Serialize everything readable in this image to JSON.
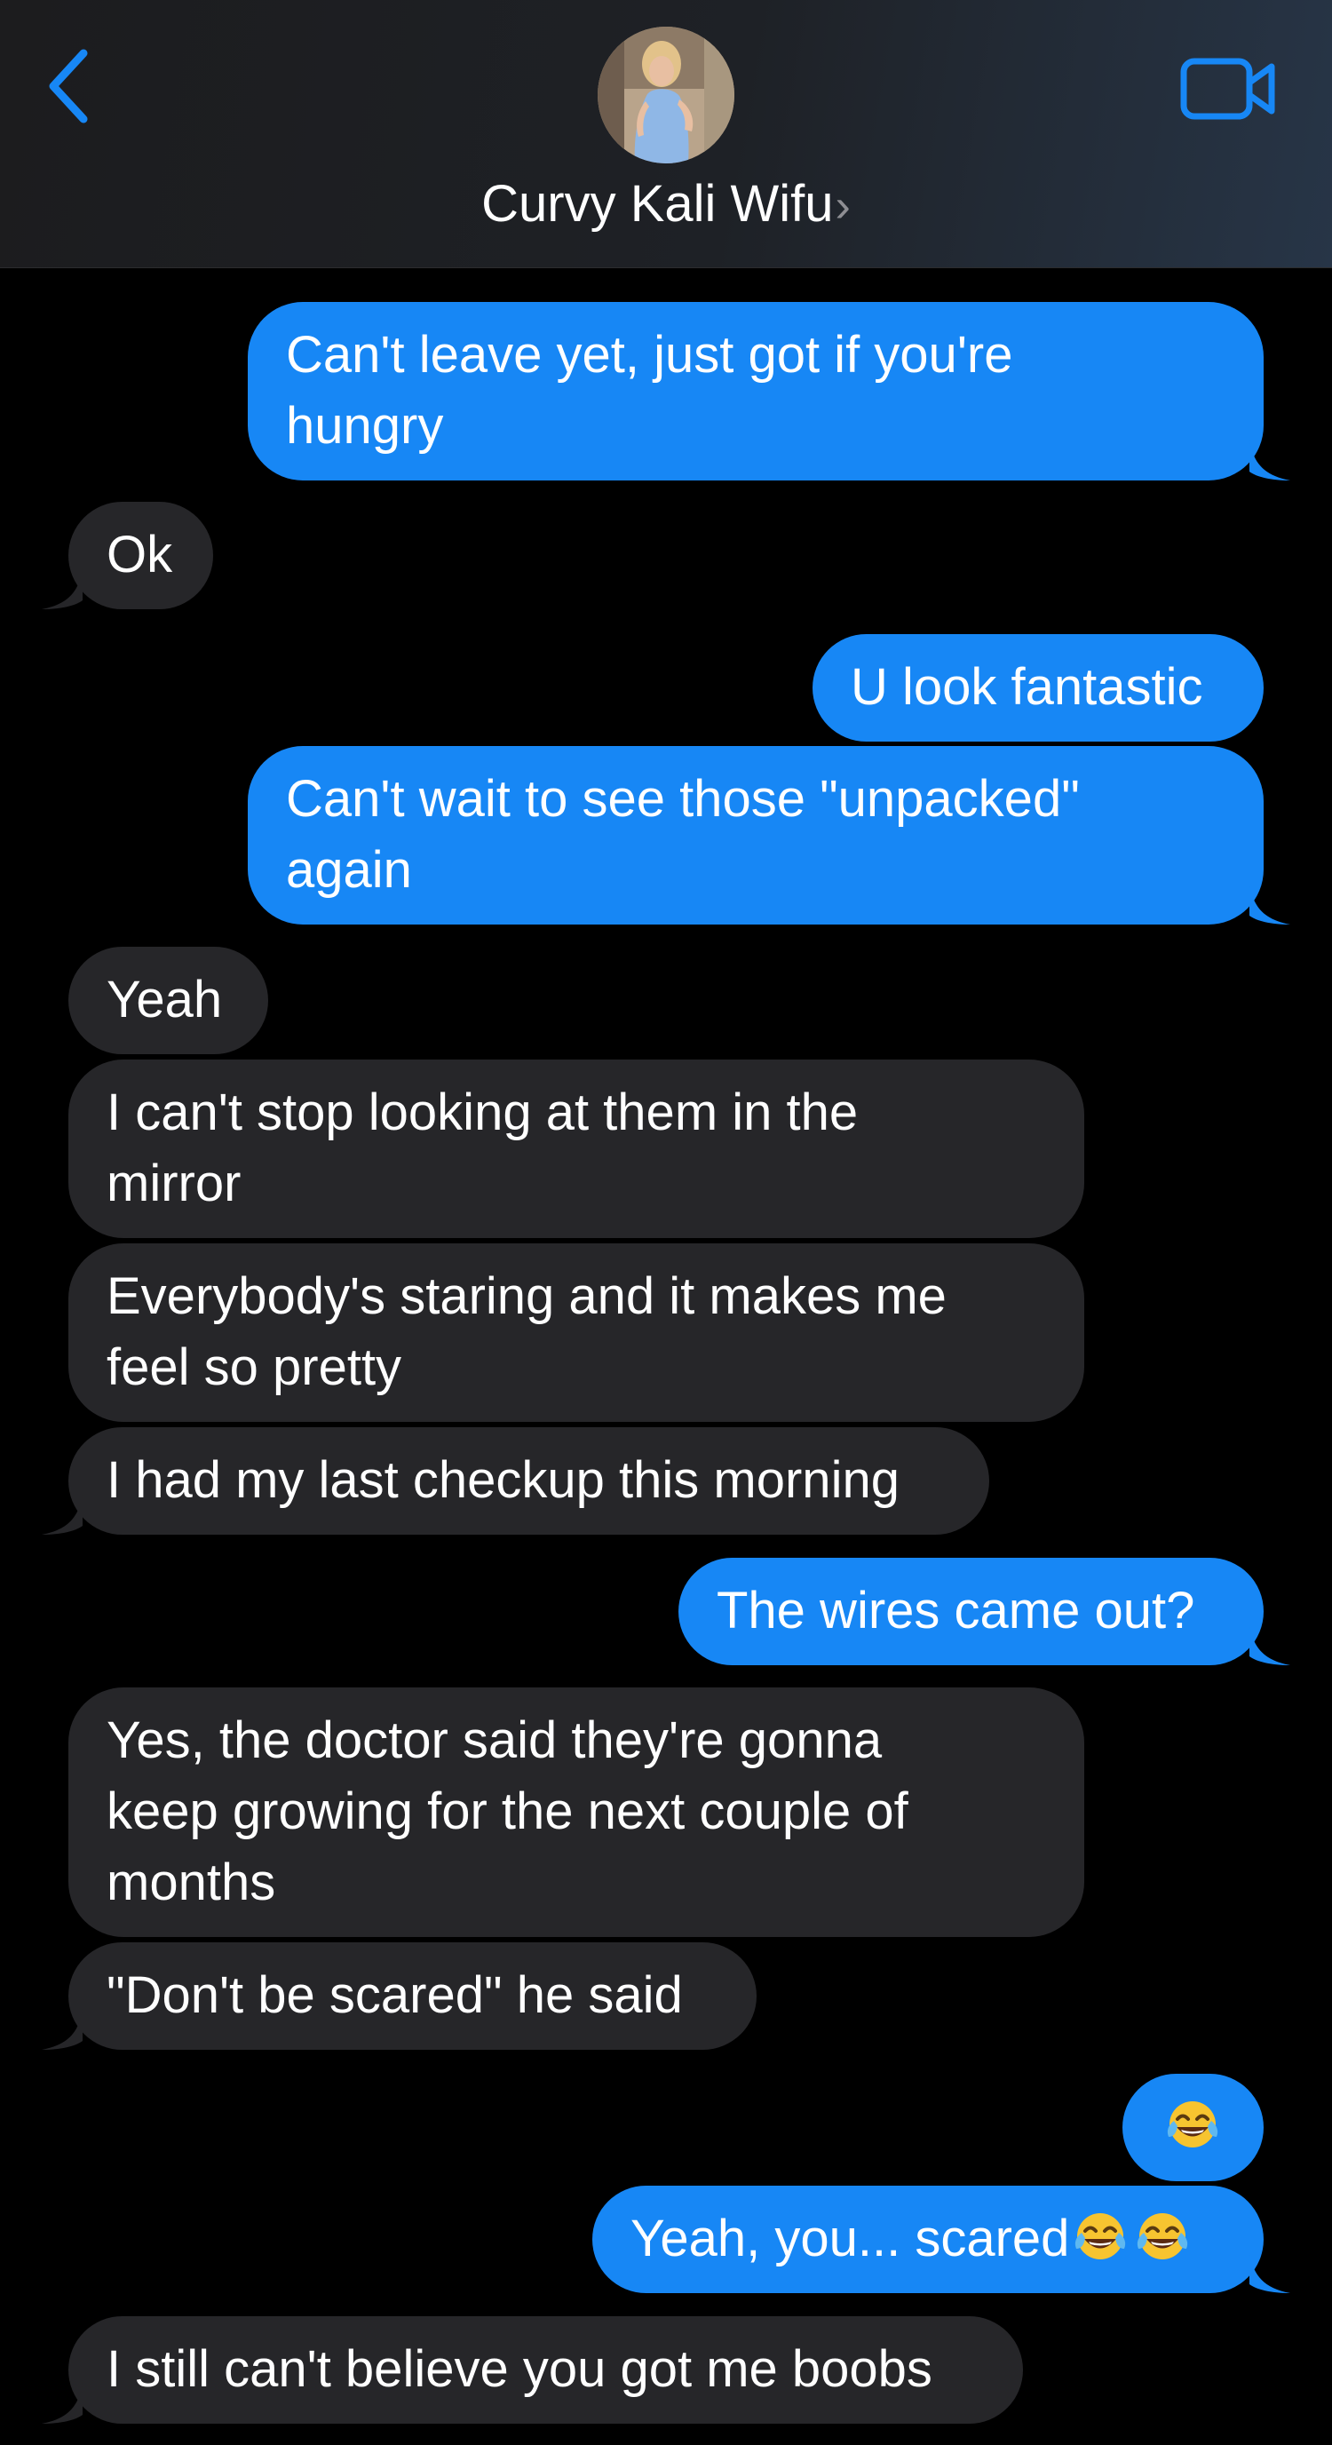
{
  "header": {
    "contact_name": "Curvy Kali Wifu",
    "chevron": "›",
    "back_icon": "chevron-left-icon",
    "video_icon": "video-camera-icon",
    "accent_color": "#1787f5"
  },
  "messages": [
    {
      "dir": "out",
      "text_lines": [
        "Can't leave yet, just got if you're",
        "hungry"
      ]
    },
    {
      "dir": "in",
      "text_lines": [
        "Ok"
      ]
    },
    {
      "dir": "out",
      "text_lines": [
        "U look fantastic"
      ]
    },
    {
      "dir": "out",
      "text_lines": [
        "Can't wait to see those \"unpacked\"",
        "again"
      ]
    },
    {
      "dir": "in",
      "text_lines": [
        "Yeah"
      ]
    },
    {
      "dir": "in",
      "text_lines": [
        "I can't stop looking at them in the",
        "mirror"
      ]
    },
    {
      "dir": "in",
      "text_lines": [
        "Everybody's staring and it makes me",
        "feel so pretty"
      ]
    },
    {
      "dir": "in",
      "text_lines": [
        "I had my last checkup this morning"
      ]
    },
    {
      "dir": "out",
      "text_lines": [
        "The wires came out?"
      ]
    },
    {
      "dir": "in",
      "text_lines": [
        "Yes, the doctor said they're gonna",
        "keep growing for the next couple of",
        "months"
      ]
    },
    {
      "dir": "in",
      "text_lines": [
        "\"Don't be scared\" he said"
      ]
    },
    {
      "dir": "out",
      "emoji_count": 1,
      "emoji": "tears-of-joy-emoji"
    },
    {
      "dir": "out",
      "text_lines": [
        "Yeah, you... scared"
      ],
      "trailing_emoji_count": 2,
      "emoji": "tears-of-joy-emoji"
    },
    {
      "dir": "in",
      "text_lines": [
        "I still can't believe you got me boobs"
      ]
    }
  ]
}
